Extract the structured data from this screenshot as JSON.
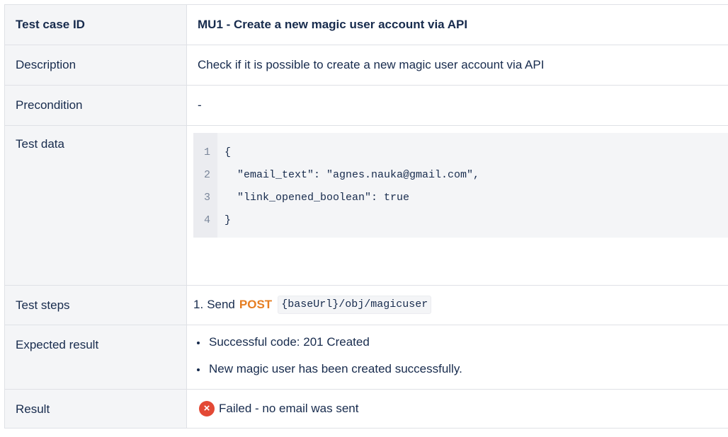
{
  "header": {
    "label": "Test case ID",
    "value": "MU1 - Create a new magic user account via API"
  },
  "description": {
    "label": "Description",
    "value": "Check if it is possible to create a new magic user account via API"
  },
  "precondition": {
    "label": "Precondition",
    "value": "-"
  },
  "test_data": {
    "label": "Test data",
    "lines": [
      {
        "num": "1",
        "text": "{"
      },
      {
        "num": "2",
        "text": "  \"email_text\": \"agnes.nauka@gmail.com\","
      },
      {
        "num": "3",
        "text": "  \"link_opened_boolean\": true"
      },
      {
        "num": "4",
        "text": "}"
      }
    ]
  },
  "test_steps": {
    "label": "Test steps",
    "number": "1.",
    "verb": "Send",
    "method": "POST",
    "endpoint": "{baseUrl}/obj/magicuser"
  },
  "expected": {
    "label": "Expected result",
    "items": [
      "Successful code: 201 Created",
      "New magic user has been created successfully."
    ]
  },
  "result": {
    "label": "Result",
    "icon": "error-icon",
    "icon_glyph": "×",
    "value": "Failed - no email was sent",
    "status_color": "#e34935"
  },
  "colors": {
    "post_method": "#e67e22",
    "header_bg": "#f4f5f7",
    "code_bg": "#f4f5f7"
  }
}
